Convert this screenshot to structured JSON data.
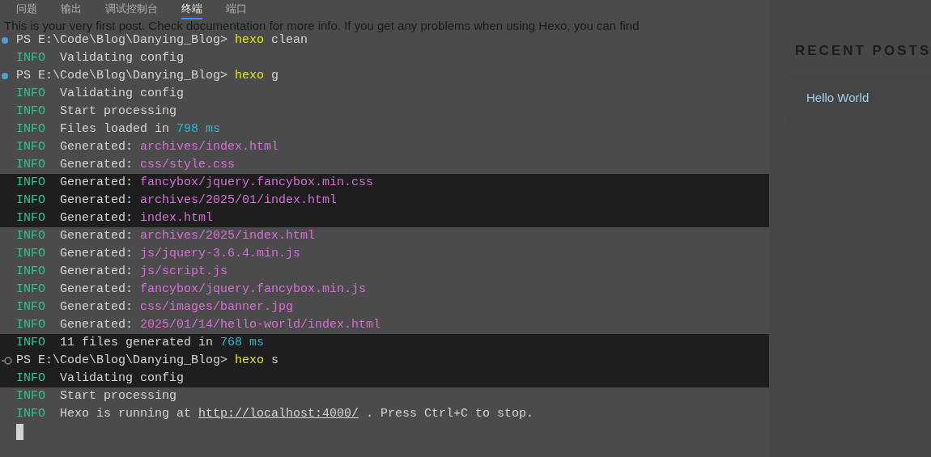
{
  "panel_tabs": [
    {
      "label": "问题",
      "selected": false
    },
    {
      "label": "输出",
      "selected": false
    },
    {
      "label": "调试控制台",
      "selected": false
    },
    {
      "label": "终端",
      "selected": true
    },
    {
      "label": "端口",
      "selected": false
    }
  ],
  "background_page": {
    "paragraph": "This is your very first post. Check documentation for more info. If you get any problems when using Hexo, you can find",
    "sidebar": {
      "heading": "RECENT POSTS",
      "posts": [
        "Hello World"
      ]
    }
  },
  "terminal": {
    "lines": [
      {
        "kind": "prompt",
        "running": false,
        "highlighted": false,
        "parts": [
          {
            "kind": "plain",
            "text": "PS E:\\Code\\Blog\\Danying_Blog> "
          },
          {
            "kind": "command",
            "text": "hexo"
          },
          {
            "kind": "plain",
            "text": " clean"
          }
        ]
      },
      {
        "kind": "info",
        "highlighted": false,
        "tag": "INFO",
        "parts": [
          {
            "kind": "plain",
            "text": "Validating config"
          }
        ]
      },
      {
        "kind": "prompt",
        "running": false,
        "highlighted": false,
        "parts": [
          {
            "kind": "plain",
            "text": "PS E:\\Code\\Blog\\Danying_Blog> "
          },
          {
            "kind": "command",
            "text": "hexo"
          },
          {
            "kind": "plain",
            "text": " g"
          }
        ]
      },
      {
        "kind": "info",
        "highlighted": false,
        "tag": "INFO",
        "parts": [
          {
            "kind": "plain",
            "text": "Validating config"
          }
        ]
      },
      {
        "kind": "info",
        "highlighted": false,
        "tag": "INFO",
        "parts": [
          {
            "kind": "plain",
            "text": "Start processing"
          }
        ]
      },
      {
        "kind": "info",
        "highlighted": false,
        "tag": "INFO",
        "parts": [
          {
            "kind": "plain",
            "text": "Files loaded in "
          },
          {
            "kind": "number",
            "text": "798 ms"
          }
        ]
      },
      {
        "kind": "info",
        "highlighted": false,
        "tag": "INFO",
        "parts": [
          {
            "kind": "plain",
            "text": "Generated: "
          },
          {
            "kind": "path",
            "text": "archives/index.html"
          }
        ]
      },
      {
        "kind": "info",
        "highlighted": false,
        "tag": "INFO",
        "parts": [
          {
            "kind": "plain",
            "text": "Generated: "
          },
          {
            "kind": "path",
            "text": "css/style.css"
          }
        ]
      },
      {
        "kind": "info",
        "highlighted": true,
        "tag": "INFO",
        "parts": [
          {
            "kind": "plain",
            "text": "Generated: "
          },
          {
            "kind": "path",
            "text": "fancybox/jquery.fancybox.min.css"
          }
        ]
      },
      {
        "kind": "info",
        "highlighted": true,
        "tag": "INFO",
        "parts": [
          {
            "kind": "plain",
            "text": "Generated: "
          },
          {
            "kind": "path",
            "text": "archives/2025/01/index.html"
          }
        ]
      },
      {
        "kind": "info",
        "highlighted": true,
        "tag": "INFO",
        "parts": [
          {
            "kind": "plain",
            "text": "Generated: "
          },
          {
            "kind": "path",
            "text": "index.html"
          }
        ]
      },
      {
        "kind": "info",
        "highlighted": false,
        "tag": "INFO",
        "parts": [
          {
            "kind": "plain",
            "text": "Generated: "
          },
          {
            "kind": "path",
            "text": "archives/2025/index.html"
          }
        ]
      },
      {
        "kind": "info",
        "highlighted": false,
        "tag": "INFO",
        "parts": [
          {
            "kind": "plain",
            "text": "Generated: "
          },
          {
            "kind": "path",
            "text": "js/jquery-3.6.4.min.js"
          }
        ]
      },
      {
        "kind": "info",
        "highlighted": false,
        "tag": "INFO",
        "parts": [
          {
            "kind": "plain",
            "text": "Generated: "
          },
          {
            "kind": "path",
            "text": "js/script.js"
          }
        ]
      },
      {
        "kind": "info",
        "highlighted": false,
        "tag": "INFO",
        "parts": [
          {
            "kind": "plain",
            "text": "Generated: "
          },
          {
            "kind": "path",
            "text": "fancybox/jquery.fancybox.min.js"
          }
        ]
      },
      {
        "kind": "info",
        "highlighted": false,
        "tag": "INFO",
        "parts": [
          {
            "kind": "plain",
            "text": "Generated: "
          },
          {
            "kind": "path",
            "text": "css/images/banner.jpg"
          }
        ]
      },
      {
        "kind": "info",
        "highlighted": false,
        "tag": "INFO",
        "parts": [
          {
            "kind": "plain",
            "text": "Generated: "
          },
          {
            "kind": "path",
            "text": "2025/01/14/hello-world/index.html"
          }
        ]
      },
      {
        "kind": "info",
        "highlighted": true,
        "tag": "INFO",
        "parts": [
          {
            "kind": "plain",
            "text": "11 files generated in "
          },
          {
            "kind": "number",
            "text": "768 ms"
          }
        ]
      },
      {
        "kind": "prompt",
        "running": true,
        "highlighted": true,
        "parts": [
          {
            "kind": "plain",
            "text": "PS E:\\Code\\Blog\\Danying_Blog> "
          },
          {
            "kind": "command",
            "text": "hexo"
          },
          {
            "kind": "plain",
            "text": " s"
          }
        ]
      },
      {
        "kind": "info",
        "highlighted": true,
        "tag": "INFO",
        "parts": [
          {
            "kind": "plain",
            "text": "Validating config"
          }
        ]
      },
      {
        "kind": "info",
        "highlighted": false,
        "tag": "INFO",
        "parts": [
          {
            "kind": "plain",
            "text": "Start processing"
          }
        ]
      },
      {
        "kind": "info",
        "highlighted": false,
        "tag": "INFO",
        "parts": [
          {
            "kind": "plain",
            "text": "Hexo is running at "
          },
          {
            "kind": "link",
            "text": "http://localhost:4000/"
          },
          {
            "kind": "plain",
            "text": " . Press Ctrl+C to stop."
          }
        ]
      }
    ]
  }
}
